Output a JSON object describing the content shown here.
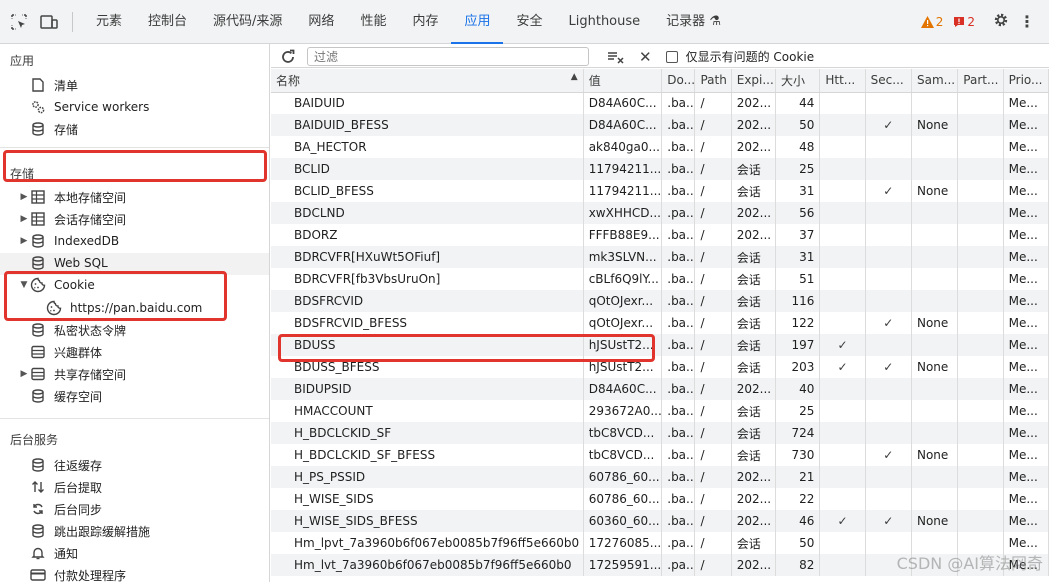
{
  "toolbar": {
    "tabs": [
      "元素",
      "控制台",
      "源代码/来源",
      "网络",
      "性能",
      "内存",
      "应用",
      "安全",
      "Lighthouse",
      "记录器 ⚗"
    ],
    "active_tab_index": 6,
    "warning_count": "2",
    "error_count": "2"
  },
  "sidebar": {
    "app_title": "应用",
    "app_items": [
      "清单",
      "Service workers",
      "存储"
    ],
    "storage_title": "存储",
    "storage_items": [
      {
        "label": "本地存储空间",
        "expandable": true
      },
      {
        "label": "会话存储空间",
        "expandable": true
      },
      {
        "label": "IndexedDB",
        "expandable": true
      },
      {
        "label": "Web SQL",
        "expandable": false
      },
      {
        "label": "Cookie",
        "expandable": true,
        "expanded": true
      },
      {
        "label": "https://pan.baidu.com",
        "child": true
      },
      {
        "label": "私密状态令牌",
        "expandable": false
      },
      {
        "label": "兴趣群体",
        "expandable": false
      },
      {
        "label": "共享存储空间",
        "expandable": true
      },
      {
        "label": "缓存空间",
        "expandable": false
      }
    ],
    "bg_title": "后台服务",
    "bg_items": [
      "往返缓存",
      "后台提取",
      "后台同步",
      "跳出跟踪缓解措施",
      "通知",
      "付款处理程序"
    ]
  },
  "filter": {
    "placeholder": "过滤",
    "only_issues_label": "仅显示有问题的 Cookie"
  },
  "table": {
    "headers": [
      "名称",
      "值",
      "Do...",
      "Path",
      "Expi...",
      "大小",
      "Htt...",
      "Sec...",
      "Sam...",
      "Part...",
      "Prio..."
    ],
    "rows": [
      [
        "BAIDUID",
        "D84A60C...",
        ".ba...",
        "/",
        "202...",
        "44",
        "",
        "",
        "",
        "",
        "Me..."
      ],
      [
        "BAIDUID_BFESS",
        "D84A60C...",
        ".ba...",
        "/",
        "202...",
        "50",
        "",
        "✓",
        "None",
        "",
        "Me..."
      ],
      [
        "BA_HECTOR",
        "ak840ga0...",
        ".ba...",
        "/",
        "202...",
        "48",
        "",
        "",
        "",
        "",
        "Me..."
      ],
      [
        "BCLID",
        "11794211...",
        ".ba...",
        "/",
        "会话",
        "25",
        "",
        "",
        "",
        "",
        "Me..."
      ],
      [
        "BCLID_BFESS",
        "11794211...",
        ".ba...",
        "/",
        "会话",
        "31",
        "",
        "✓",
        "None",
        "",
        "Me..."
      ],
      [
        "BDCLND",
        "xwXHHCD...",
        ".pa...",
        "/",
        "202...",
        "56",
        "",
        "",
        "",
        "",
        "Me..."
      ],
      [
        "BDORZ",
        "FFFB88E9...",
        ".ba...",
        "/",
        "202...",
        "37",
        "",
        "",
        "",
        "",
        "Me..."
      ],
      [
        "BDRCVFR[HXuWt5OFiuf]",
        "mk3SLVN...",
        ".ba...",
        "/",
        "会话",
        "31",
        "",
        "",
        "",
        "",
        "Me..."
      ],
      [
        "BDRCVFR[fb3VbsUruOn]",
        "cBLf6Q9lY...",
        ".ba...",
        "/",
        "会话",
        "51",
        "",
        "",
        "",
        "",
        "Me..."
      ],
      [
        "BDSFRCVID",
        "qOtOJexr...",
        ".ba...",
        "/",
        "会话",
        "116",
        "",
        "",
        "",
        "",
        "Me..."
      ],
      [
        "BDSFRCVID_BFESS",
        "qOtOJexr...",
        ".ba...",
        "/",
        "会话",
        "122",
        "",
        "✓",
        "None",
        "",
        "Me..."
      ],
      [
        "BDUSS",
        "hJSUstT2...",
        ".ba...",
        "/",
        "会话",
        "197",
        "✓",
        "",
        "",
        "",
        "Me..."
      ],
      [
        "BDUSS_BFESS",
        "hJSUstT2...",
        ".ba...",
        "/",
        "会话",
        "203",
        "✓",
        "✓",
        "None",
        "",
        "Me..."
      ],
      [
        "BIDUPSID",
        "D84A60C...",
        ".ba...",
        "/",
        "202...",
        "40",
        "",
        "",
        "",
        "",
        "Me..."
      ],
      [
        "HMACCOUNT",
        "293672A0...",
        ".ba...",
        "/",
        "会话",
        "25",
        "",
        "",
        "",
        "",
        "Me..."
      ],
      [
        "H_BDCLCKID_SF",
        "tbC8VCD...",
        ".ba...",
        "/",
        "会话",
        "724",
        "",
        "",
        "",
        "",
        "Me..."
      ],
      [
        "H_BDCLCKID_SF_BFESS",
        "tbC8VCD...",
        ".ba...",
        "/",
        "会话",
        "730",
        "",
        "✓",
        "None",
        "",
        "Me..."
      ],
      [
        "H_PS_PSSID",
        "60786_60...",
        ".ba...",
        "/",
        "202...",
        "21",
        "",
        "",
        "",
        "",
        "Me..."
      ],
      [
        "H_WISE_SIDS",
        "60786_60...",
        ".ba...",
        "/",
        "202...",
        "22",
        "",
        "",
        "",
        "",
        "Me..."
      ],
      [
        "H_WISE_SIDS_BFESS",
        "60360_60...",
        ".ba...",
        "/",
        "202...",
        "46",
        "✓",
        "✓",
        "None",
        "",
        "Me..."
      ],
      [
        "Hm_lpvt_7a3960b6f067eb0085b7f96ff5e660b0",
        "17276085...",
        ".pa...",
        "/",
        "会话",
        "50",
        "",
        "",
        "",
        "",
        "Me..."
      ],
      [
        "Hm_lvt_7a3960b6f067eb0085b7f96ff5e660b0",
        "17259591...",
        ".pa...",
        "/",
        "202...",
        "82",
        "",
        "",
        "",
        "",
        "Me..."
      ]
    ]
  },
  "watermark": "CSDN @AI算法网奇"
}
